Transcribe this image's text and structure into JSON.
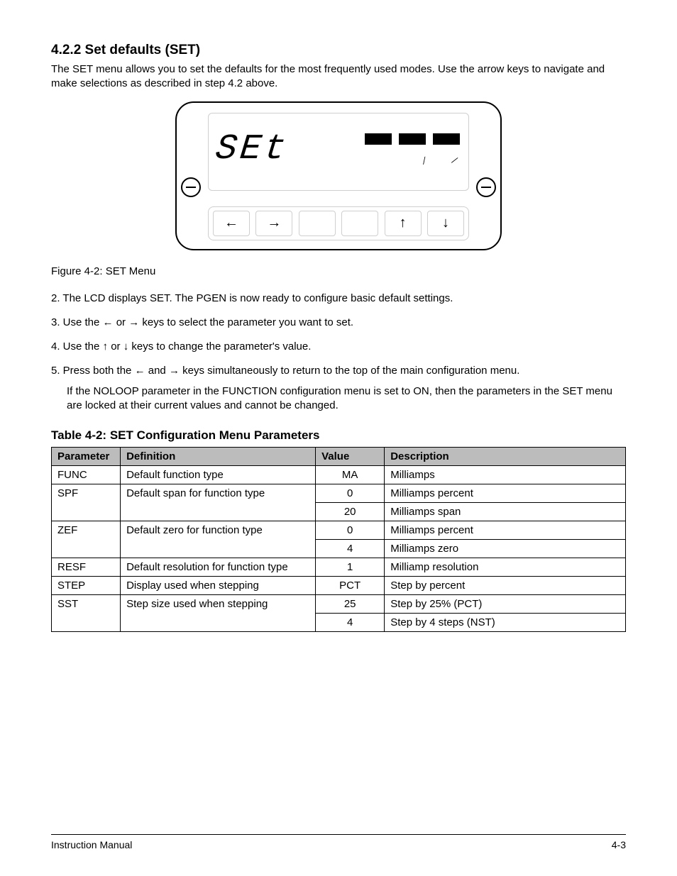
{
  "section": {
    "title": "4.2.2 Set defaults (SET)",
    "para1": "The SET menu allows you to set the defaults for the most frequently used modes. Use the arrow keys to navigate and make selections as described in step 4.2 above.",
    "figure_caption": "Figure 4-2: SET Menu",
    "step2": "2. The LCD displays SET. The PGEN is now ready to configure basic default settings.",
    "step3prefix": "3. Use the",
    "step3mid": "or",
    "step3suffix": "keys to select the parameter you want to set.",
    "step4prefix": "4. Use the",
    "step4mid": "or",
    "step4suffix": "keys to change the parameter's value.",
    "step5prefix": "5. Press both the",
    "step5mid": "and",
    "step5suffix": "keys simultaneously to return to the top of the main configuration menu.",
    "noloop_note": "If the NOLOOP parameter in the FUNCTION configuration menu is set to ON, then the parameters in the SET menu are locked at their current values and cannot be changed."
  },
  "panel": {
    "display_text": "SEt",
    "buttons": [
      "left-arrow",
      "right-arrow",
      "blank",
      "blank",
      "up-arrow",
      "down-arrow"
    ]
  },
  "table": {
    "title": "Table 4-2: SET Configuration Menu Parameters",
    "headers": [
      "Parameter",
      "Definition",
      "Value",
      "Description"
    ],
    "rows": [
      {
        "p": "FUNC",
        "d": "Default function type",
        "cells": [
          {
            "v": "MA",
            "desc": "Milliamps"
          }
        ]
      },
      {
        "p": "SPF",
        "d": "Default span for function type",
        "cells": [
          {
            "v": "0",
            "desc": "Milliamps percent"
          },
          {
            "v": "20",
            "desc": "Milliamps span"
          }
        ]
      },
      {
        "p": "ZEF",
        "d": "Default zero for function type",
        "cells": [
          {
            "v": "0",
            "desc": "Milliamps percent"
          },
          {
            "v": "4",
            "desc": "Milliamps zero"
          }
        ]
      },
      {
        "p": "RESF",
        "d": "Default resolution for function type",
        "cells": [
          {
            "v": "1",
            "desc": "Milliamp resolution"
          }
        ]
      },
      {
        "p": "STEP",
        "d": "Display used when stepping",
        "cells": [
          {
            "v": "PCT",
            "desc": "Step by percent"
          }
        ]
      },
      {
        "p": "SST",
        "d": "Step size used when stepping",
        "cells": [
          {
            "v": "25",
            "desc": "Step by 25% (PCT)"
          },
          {
            "v": "4",
            "desc": "Step by 4 steps (NST)"
          }
        ]
      }
    ]
  },
  "footer": {
    "left": "Instruction Manual",
    "right": "4-3"
  }
}
